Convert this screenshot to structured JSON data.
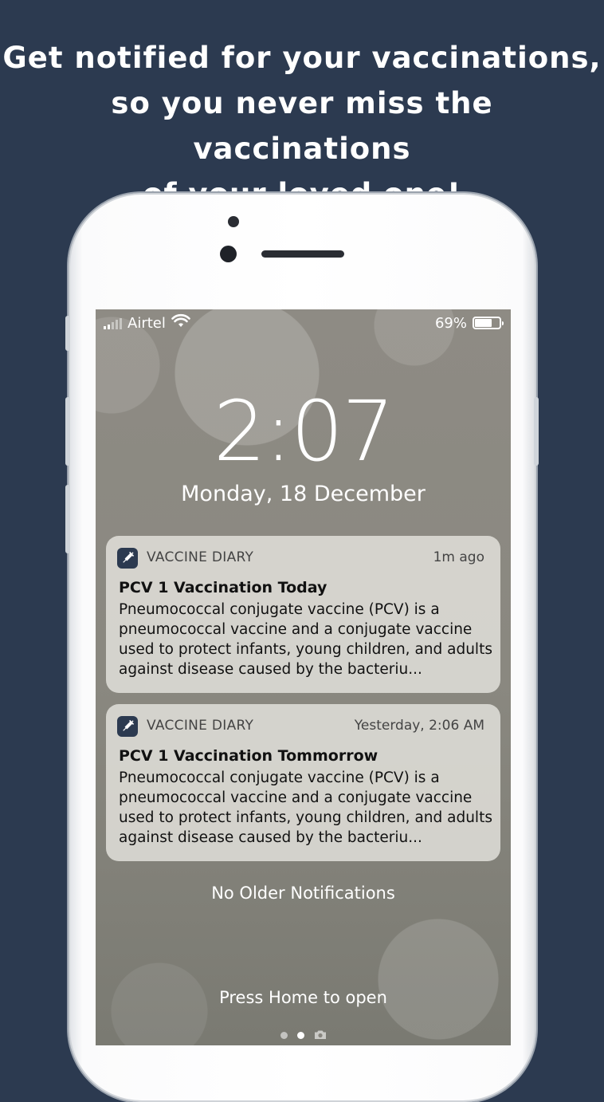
{
  "promo": {
    "line1": "Get notified for your vaccinations,",
    "line2": "so you never miss the vaccinations",
    "line3": "of your loved one!"
  },
  "status_bar": {
    "carrier": "Airtel",
    "battery_percent": "69%",
    "battery_level": 0.69,
    "wifi_icon": "wifi-icon",
    "signal_icon": "signal-bars-icon"
  },
  "lock_screen": {
    "time": "2:07",
    "date": "Monday, 18 December"
  },
  "notifications": [
    {
      "app": "VACCINE DIARY",
      "when": "1m ago",
      "title": "PCV 1 Vaccination Today",
      "body": "Pneumococcal conjugate vaccine (PCV) is a pneumococcal vaccine and a conjugate vaccine used to protect infants, young children, and adults against disease caused by the bacteriu...",
      "icon": "syringe-icon"
    },
    {
      "app": "VACCINE DIARY",
      "when": "Yesterday, 2:06 AM",
      "title": "PCV 1 Vaccination Tommorrow",
      "body": "Pneumococcal conjugate vaccine (PCV) is a pneumococcal vaccine and a conjugate vaccine used to protect infants, young children, and adults against disease caused by the bacteriu...",
      "icon": "syringe-icon"
    }
  ],
  "footer": {
    "no_older": "No Older Notifications",
    "press_home": "Press Home to open"
  },
  "colors": {
    "background": "#2c3a50",
    "app_icon_bg": "#2c3a50"
  }
}
